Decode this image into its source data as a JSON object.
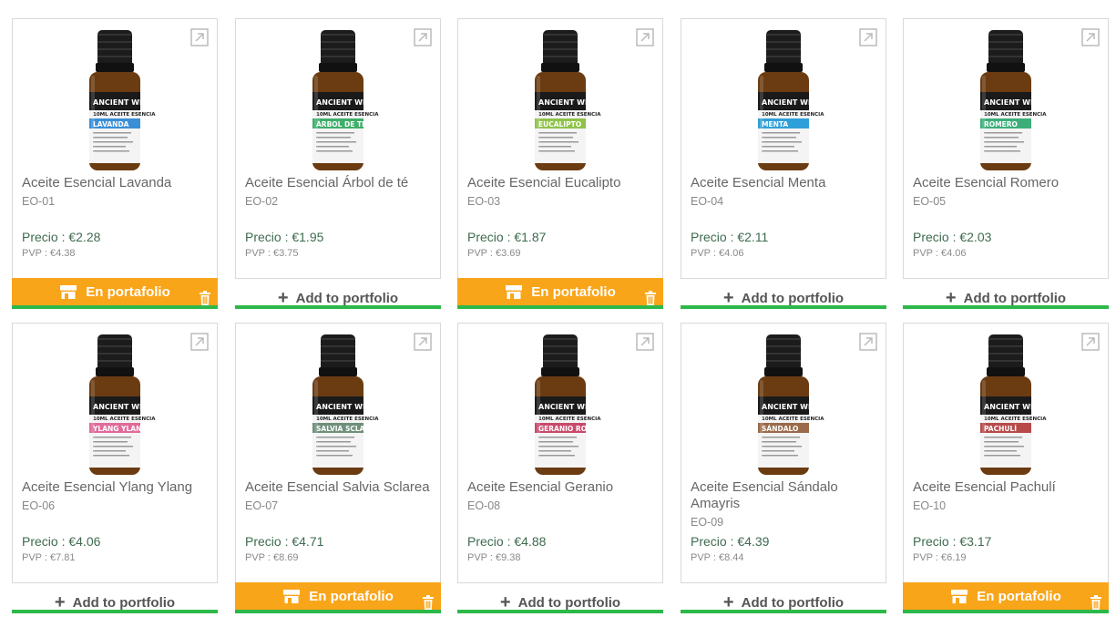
{
  "labels": {
    "price_prefix": "Precio : ",
    "pvp_prefix": "PVP : ",
    "in_portfolio": "En portafolio",
    "add_to_portfolio": "Add to portfolio"
  },
  "colors": {
    "accent_orange": "#f9a51a",
    "accent_green": "#2db84a",
    "price_green": "#3e6b4f"
  },
  "products": [
    {
      "name": "Aceite Esencial Lavanda",
      "code": "EO-01",
      "price": "€2.28",
      "pvp": "€4.38",
      "in_portfolio": true,
      "label_text": "LAVANDA",
      "label_color": "#3a8fd6"
    },
    {
      "name": "Aceite Esencial Árbol de té",
      "code": "EO-02",
      "price": "€1.95",
      "pvp": "€3.75",
      "in_portfolio": false,
      "label_text": "ÁRBOL DE TÉ",
      "label_color": "#3fae6a"
    },
    {
      "name": "Aceite Esencial Eucalipto",
      "code": "EO-03",
      "price": "€1.87",
      "pvp": "€3.69",
      "in_portfolio": true,
      "label_text": "EUCALIPTO",
      "label_color": "#8fc24a"
    },
    {
      "name": "Aceite Esencial Menta",
      "code": "EO-04",
      "price": "€2.11",
      "pvp": "€4.06",
      "in_portfolio": false,
      "label_text": "MENTA",
      "label_color": "#2f9fd8"
    },
    {
      "name": "Aceite Esencial Romero",
      "code": "EO-05",
      "price": "€2.03",
      "pvp": "€4.06",
      "in_portfolio": false,
      "label_text": "ROMERO",
      "label_color": "#3dae7a"
    },
    {
      "name": "Aceite Esencial Ylang Ylang",
      "code": "EO-06",
      "price": "€4.06",
      "pvp": "€7.81",
      "in_portfolio": false,
      "label_text": "YLANG YLANG",
      "label_color": "#e06a9a"
    },
    {
      "name": "Aceite Esencial Salvia Sclarea",
      "code": "EO-07",
      "price": "€4.71",
      "pvp": "€8.69",
      "in_portfolio": true,
      "label_text": "SALVIA SCLAREA",
      "label_color": "#6f8f7a"
    },
    {
      "name": "Aceite Esencial Geranio",
      "code": "EO-08",
      "price": "€4.88",
      "pvp": "€9.38",
      "in_portfolio": false,
      "label_text": "GERANIO ROSA",
      "label_color": "#c84a6a"
    },
    {
      "name": "Aceite Esencial Sándalo Amayris",
      "code": "EO-09",
      "price": "€4.39",
      "pvp": "€8.44",
      "in_portfolio": false,
      "label_text": "SÁNDALO",
      "label_color": "#9a6a4a"
    },
    {
      "name": "Aceite Esencial Pachulí",
      "code": "EO-10",
      "price": "€3.17",
      "pvp": "€6.19",
      "in_portfolio": true,
      "label_text": "PACHULÍ",
      "label_color": "#b84a4a"
    }
  ],
  "bottle_text": {
    "brand": "ANCIENT WISDOM",
    "sub": "10ML ACEITE ESENCIAL"
  }
}
